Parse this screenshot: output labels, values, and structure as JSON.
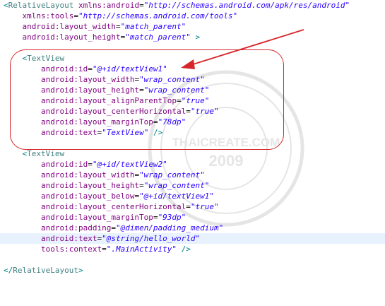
{
  "editor": {
    "lines": [
      {
        "indent": "",
        "parts": [
          {
            "type": "bracket",
            "text": "<"
          },
          {
            "type": "tag",
            "text": "RelativeLayout"
          },
          {
            "type": "text",
            "text": " "
          },
          {
            "type": "attr",
            "text": "xmlns:android"
          },
          {
            "type": "eq",
            "text": "="
          },
          {
            "type": "val",
            "text": "\"http://schemas.android.com/apk/res/android\""
          }
        ]
      },
      {
        "indent": "    ",
        "parts": [
          {
            "type": "attr",
            "text": "xmlns:tools"
          },
          {
            "type": "eq",
            "text": "="
          },
          {
            "type": "val",
            "text": "\"http://schemas.android.com/tools\""
          }
        ]
      },
      {
        "indent": "    ",
        "parts": [
          {
            "type": "attr",
            "text": "android:layout_width"
          },
          {
            "type": "eq",
            "text": "="
          },
          {
            "type": "val",
            "text": "\"match_parent\""
          }
        ]
      },
      {
        "indent": "    ",
        "parts": [
          {
            "type": "attr",
            "text": "android:layout_height"
          },
          {
            "type": "eq",
            "text": "="
          },
          {
            "type": "val",
            "text": "\"match_parent\""
          },
          {
            "type": "text",
            "text": " "
          },
          {
            "type": "bracket",
            "text": ">"
          }
        ]
      },
      {
        "indent": "",
        "parts": []
      },
      {
        "indent": "    ",
        "parts": [
          {
            "type": "bracket",
            "text": "<"
          },
          {
            "type": "tag",
            "text": "TextView"
          }
        ]
      },
      {
        "indent": "        ",
        "parts": [
          {
            "type": "attr",
            "text": "android:id"
          },
          {
            "type": "eq",
            "text": "="
          },
          {
            "type": "val",
            "text": "\"@+id/textView1\""
          }
        ]
      },
      {
        "indent": "        ",
        "parts": [
          {
            "type": "attr",
            "text": "android:layout_width"
          },
          {
            "type": "eq",
            "text": "="
          },
          {
            "type": "val",
            "text": "\"wrap_content\""
          }
        ]
      },
      {
        "indent": "        ",
        "parts": [
          {
            "type": "attr",
            "text": "android:layout_height"
          },
          {
            "type": "eq",
            "text": "="
          },
          {
            "type": "val",
            "text": "\"wrap_content\""
          }
        ]
      },
      {
        "indent": "        ",
        "parts": [
          {
            "type": "attr",
            "text": "android:layout_alignParentTop"
          },
          {
            "type": "eq",
            "text": "="
          },
          {
            "type": "val",
            "text": "\"true\""
          }
        ]
      },
      {
        "indent": "        ",
        "parts": [
          {
            "type": "attr",
            "text": "android:layout_centerHorizontal"
          },
          {
            "type": "eq",
            "text": "="
          },
          {
            "type": "val",
            "text": "\"true\""
          }
        ]
      },
      {
        "indent": "        ",
        "parts": [
          {
            "type": "attr",
            "text": "android:layout_marginTop"
          },
          {
            "type": "eq",
            "text": "="
          },
          {
            "type": "val",
            "text": "\"78dp\""
          }
        ]
      },
      {
        "indent": "        ",
        "parts": [
          {
            "type": "attr",
            "text": "android:text"
          },
          {
            "type": "eq",
            "text": "="
          },
          {
            "type": "val",
            "text": "\"TextView\""
          },
          {
            "type": "text",
            "text": " "
          },
          {
            "type": "bracket",
            "text": "/>"
          }
        ]
      },
      {
        "indent": "",
        "parts": []
      },
      {
        "indent": "    ",
        "parts": [
          {
            "type": "bracket",
            "text": "<"
          },
          {
            "type": "tag",
            "text": "TextView"
          }
        ]
      },
      {
        "indent": "        ",
        "parts": [
          {
            "type": "attr",
            "text": "android:id"
          },
          {
            "type": "eq",
            "text": "="
          },
          {
            "type": "val",
            "text": "\"@+id/textView2\""
          }
        ]
      },
      {
        "indent": "        ",
        "parts": [
          {
            "type": "attr",
            "text": "android:layout_width"
          },
          {
            "type": "eq",
            "text": "="
          },
          {
            "type": "val",
            "text": "\"wrap_content\""
          }
        ]
      },
      {
        "indent": "        ",
        "parts": [
          {
            "type": "attr",
            "text": "android:layout_height"
          },
          {
            "type": "eq",
            "text": "="
          },
          {
            "type": "val",
            "text": "\"wrap_content\""
          }
        ]
      },
      {
        "indent": "        ",
        "parts": [
          {
            "type": "attr",
            "text": "android:layout_below"
          },
          {
            "type": "eq",
            "text": "="
          },
          {
            "type": "val",
            "text": "\"@+id/textView1\""
          }
        ]
      },
      {
        "indent": "        ",
        "parts": [
          {
            "type": "attr",
            "text": "android:layout_centerHorizontal"
          },
          {
            "type": "eq",
            "text": "="
          },
          {
            "type": "val",
            "text": "\"true\""
          }
        ]
      },
      {
        "indent": "        ",
        "parts": [
          {
            "type": "attr",
            "text": "android:layout_marginTop"
          },
          {
            "type": "eq",
            "text": "="
          },
          {
            "type": "val",
            "text": "\"93dp\""
          }
        ]
      },
      {
        "indent": "        ",
        "parts": [
          {
            "type": "attr",
            "text": "android:padding"
          },
          {
            "type": "eq",
            "text": "="
          },
          {
            "type": "val",
            "text": "\"@dimen/padding_medium\""
          }
        ]
      },
      {
        "indent": "        ",
        "highlight": true,
        "parts": [
          {
            "type": "attr",
            "text": "android:text"
          },
          {
            "type": "eq",
            "text": "="
          },
          {
            "type": "val",
            "text": "\"@string/hello_world\""
          }
        ]
      },
      {
        "indent": "        ",
        "parts": [
          {
            "type": "attr",
            "text": "tools:context"
          },
          {
            "type": "eq",
            "text": "="
          },
          {
            "type": "val",
            "text": "\".MainActivity\""
          },
          {
            "type": "text",
            "text": " "
          },
          {
            "type": "bracket",
            "text": "/>"
          }
        ]
      },
      {
        "indent": "",
        "parts": []
      },
      {
        "indent": "",
        "parts": [
          {
            "type": "bracket",
            "text": "</"
          },
          {
            "type": "tag",
            "text": "RelativeLayout"
          },
          {
            "type": "bracket",
            "text": ">"
          }
        ]
      }
    ]
  },
  "annotation": {
    "box_color": "#d6262a",
    "arrow_color": "#d6262a"
  },
  "watermark": {
    "site": "THAICREATE.COM",
    "year": "2009"
  }
}
